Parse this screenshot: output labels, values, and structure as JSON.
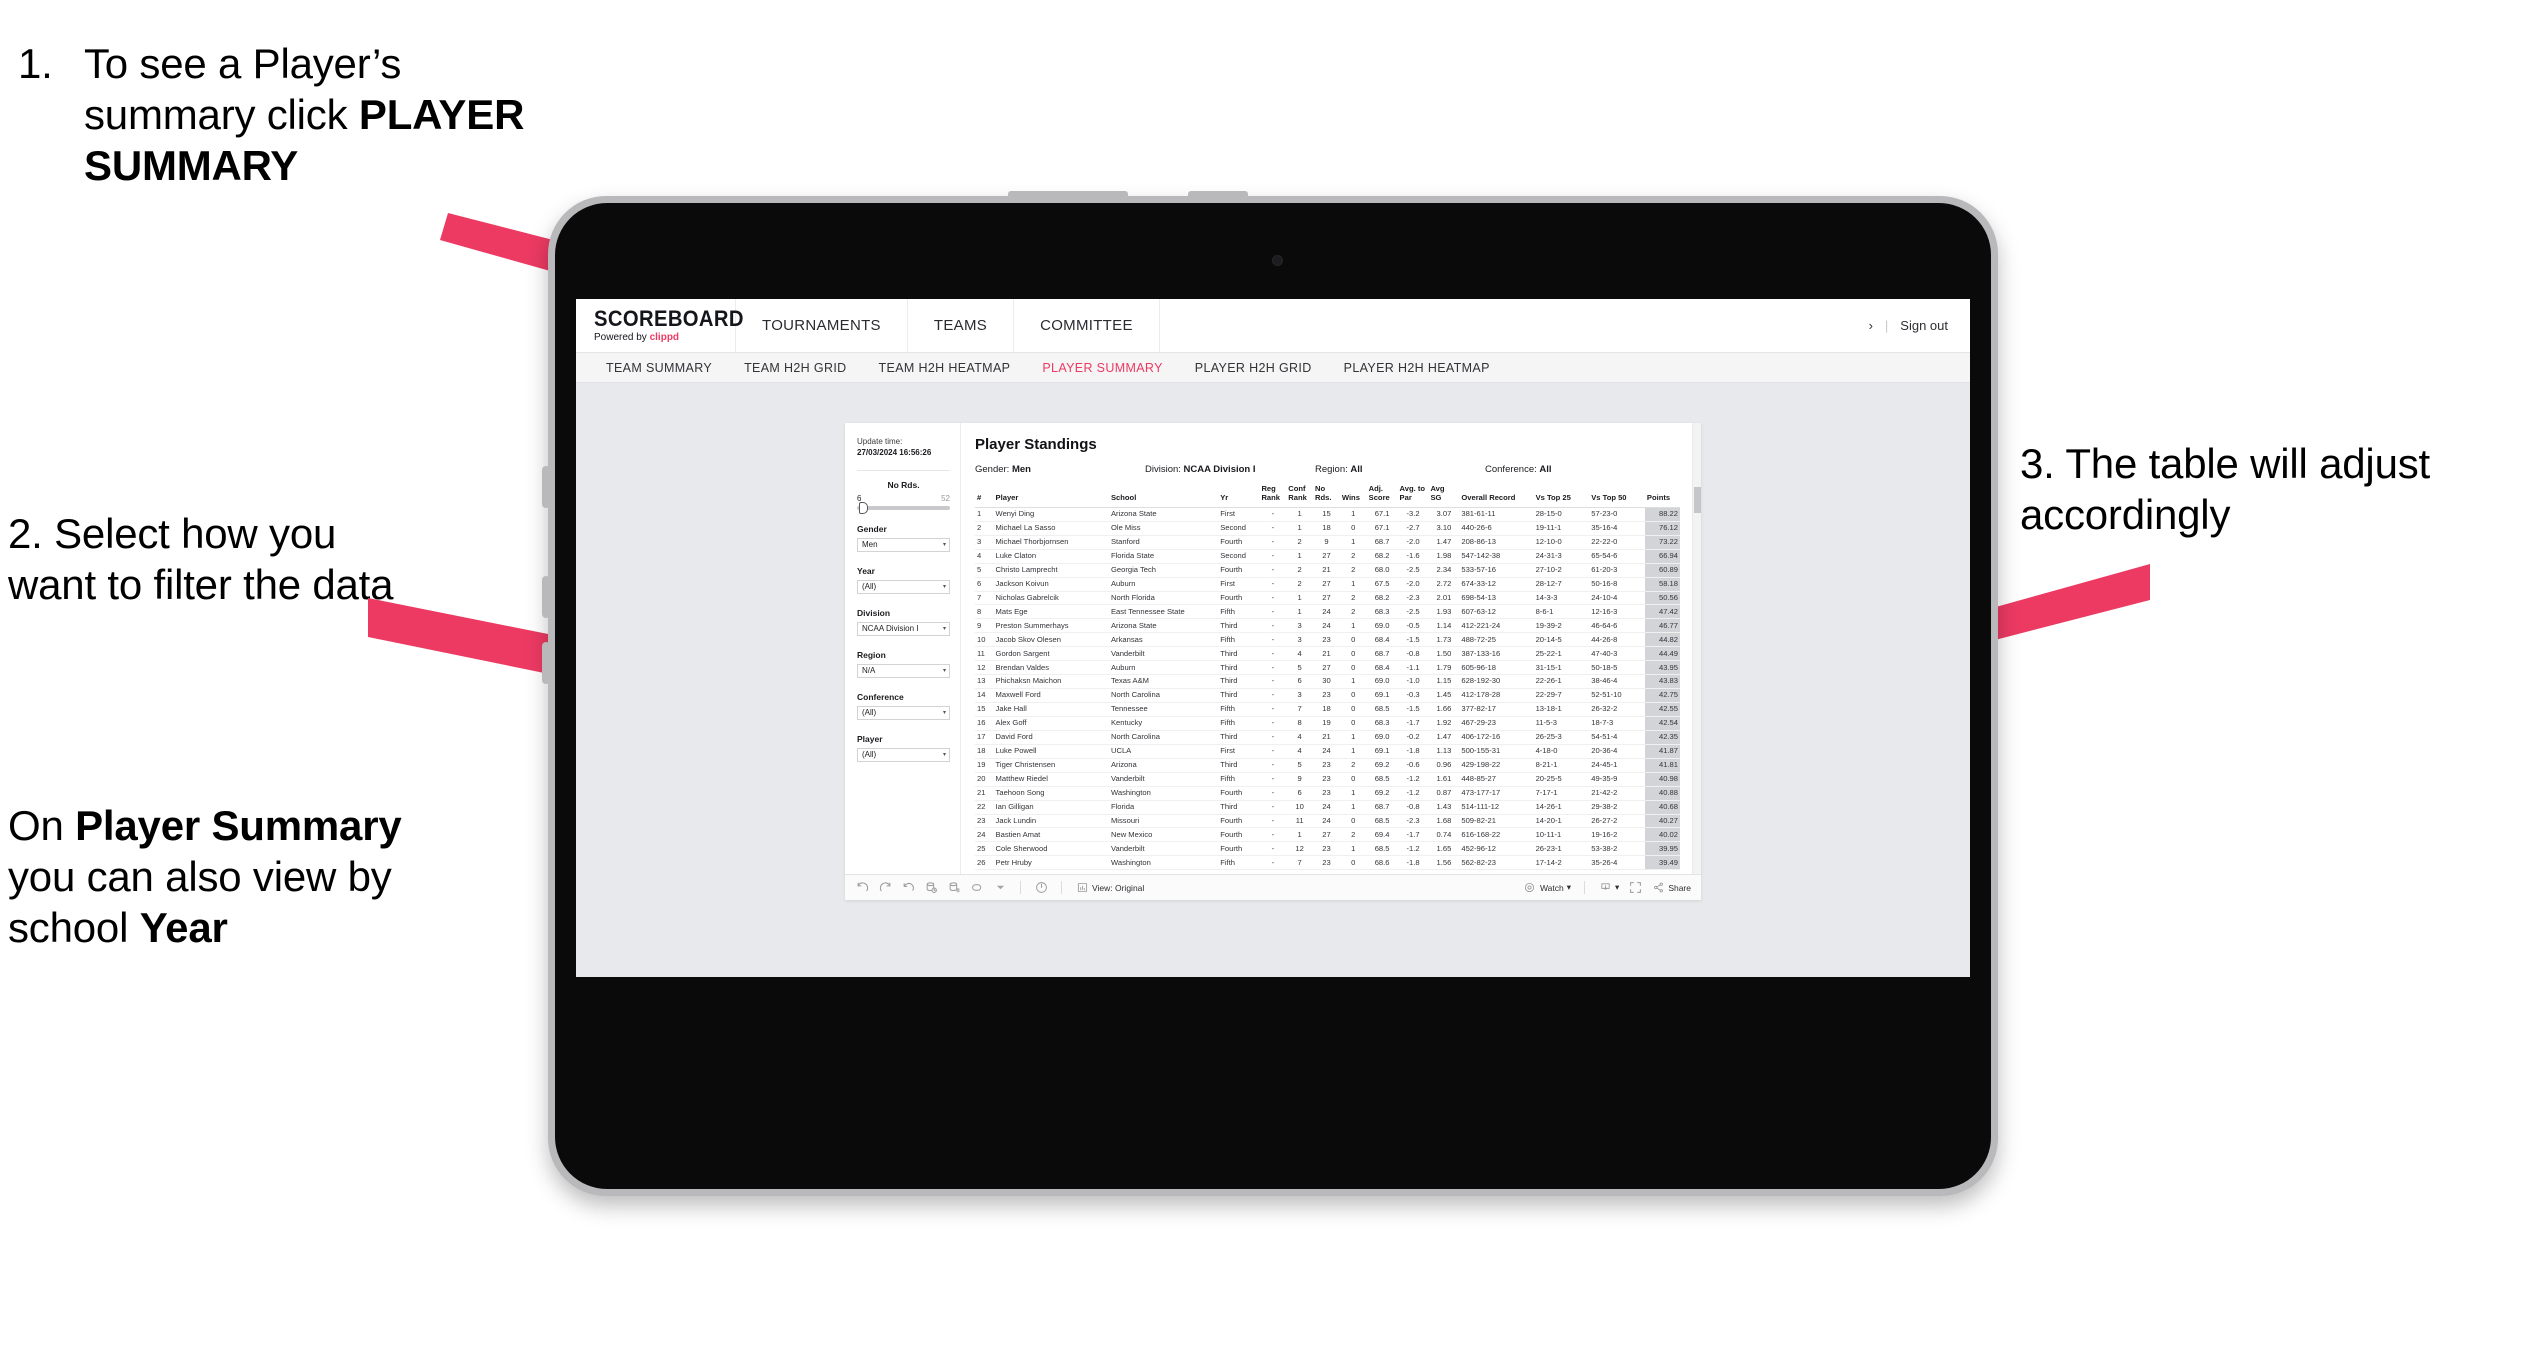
{
  "annotations": {
    "one": {
      "number": "1.",
      "text_before": "To see a Player’s summary click ",
      "bold": "PLAYER SUMMARY"
    },
    "two": {
      "text": "2. Select how you want to filter the data"
    },
    "two_b": {
      "prefix": "On ",
      "bold1": "Player Summary",
      "middle": " you can also view by school ",
      "bold2": "Year"
    },
    "three": {
      "text": "3. The table will adjust accordingly"
    },
    "arrow_color": "#ec3a63"
  },
  "app": {
    "brand": {
      "name": "SCOREBOARD",
      "powered_prefix": "Powered by ",
      "powered_brand": "clippd"
    },
    "nav": [
      {
        "label": "TOURNAMENTS"
      },
      {
        "label": "TEAMS"
      },
      {
        "label": "COMMITTEE"
      }
    ],
    "nav_right": {
      "chevron": "›",
      "divider": "|",
      "sign_out": "Sign out"
    },
    "subnav": [
      {
        "label": "TEAM SUMMARY",
        "active": false
      },
      {
        "label": "TEAM H2H GRID",
        "active": false
      },
      {
        "label": "TEAM H2H HEATMAP",
        "active": false
      },
      {
        "label": "PLAYER SUMMARY",
        "active": true
      },
      {
        "label": "PLAYER H2H GRID",
        "active": false
      },
      {
        "label": "PLAYER H2H HEATMAP",
        "active": false
      }
    ],
    "accent_color": "#ec3a63"
  },
  "filters": {
    "update_label": "Update time:",
    "update_time": "27/03/2024 16:56:26",
    "slider": {
      "title": "No Rds.",
      "min": "6",
      "max": "52"
    },
    "selects": [
      {
        "title": "Gender",
        "value": "Men"
      },
      {
        "title": "Year",
        "value": "(All)"
      },
      {
        "title": "Division",
        "value": "NCAA Division I"
      },
      {
        "title": "Region",
        "value": "N/A"
      },
      {
        "title": "Conference",
        "value": "(All)"
      },
      {
        "title": "Player",
        "value": "(All)"
      }
    ],
    "caret": "▾"
  },
  "standings": {
    "title": "Player Standings",
    "summary": [
      {
        "label": "Gender: ",
        "value": "Men"
      },
      {
        "label": "Division: ",
        "value": "NCAA Division I"
      },
      {
        "label": "Region: ",
        "value": "All"
      },
      {
        "label": "Conference: ",
        "value": "All"
      }
    ],
    "columns": [
      "#",
      "Player",
      "School",
      "Yr",
      "Reg Rank",
      "Conf Rank",
      "No Rds.",
      "Wins",
      "Adj. Score",
      "Avg. to Par",
      "Avg SG",
      "Overall Record",
      "Vs Top 25",
      "Vs Top 50",
      "Points"
    ],
    "rows": [
      [
        "1",
        "Wenyi Ding",
        "Arizona State",
        "First",
        "-",
        "1",
        "15",
        "1",
        "67.1",
        "-3.2",
        "3.07",
        "381-61-11",
        "28-15-0",
        "57-23-0",
        "88.22"
      ],
      [
        "2",
        "Michael La Sasso",
        "Ole Miss",
        "Second",
        "-",
        "1",
        "18",
        "0",
        "67.1",
        "-2.7",
        "3.10",
        "440-26-6",
        "19-11-1",
        "35-16-4",
        "76.12"
      ],
      [
        "3",
        "Michael Thorbjornsen",
        "Stanford",
        "Fourth",
        "-",
        "2",
        "9",
        "1",
        "68.7",
        "-2.0",
        "1.47",
        "208-86-13",
        "12-10-0",
        "22-22-0",
        "73.22"
      ],
      [
        "4",
        "Luke Claton",
        "Florida State",
        "Second",
        "-",
        "1",
        "27",
        "2",
        "68.2",
        "-1.6",
        "1.98",
        "547-142-38",
        "24-31-3",
        "65-54-6",
        "66.94"
      ],
      [
        "5",
        "Christo Lamprecht",
        "Georgia Tech",
        "Fourth",
        "-",
        "2",
        "21",
        "2",
        "68.0",
        "-2.5",
        "2.34",
        "533-57-16",
        "27-10-2",
        "61-20-3",
        "60.89"
      ],
      [
        "6",
        "Jackson Koivun",
        "Auburn",
        "First",
        "-",
        "2",
        "27",
        "1",
        "67.5",
        "-2.0",
        "2.72",
        "674-33-12",
        "28-12-7",
        "50-16-8",
        "58.18"
      ],
      [
        "7",
        "Nicholas Gabrelcik",
        "North Florida",
        "Fourth",
        "-",
        "1",
        "27",
        "2",
        "68.2",
        "-2.3",
        "2.01",
        "698-54-13",
        "14-3-3",
        "24-10-4",
        "50.56"
      ],
      [
        "8",
        "Mats Ege",
        "East Tennessee State",
        "Fifth",
        "-",
        "1",
        "24",
        "2",
        "68.3",
        "-2.5",
        "1.93",
        "607-63-12",
        "8-6-1",
        "12-16-3",
        "47.42"
      ],
      [
        "9",
        "Preston Summerhays",
        "Arizona State",
        "Third",
        "-",
        "3",
        "24",
        "1",
        "69.0",
        "-0.5",
        "1.14",
        "412-221-24",
        "19-39-2",
        "46-64-6",
        "46.77"
      ],
      [
        "10",
        "Jacob Skov Olesen",
        "Arkansas",
        "Fifth",
        "-",
        "3",
        "23",
        "0",
        "68.4",
        "-1.5",
        "1.73",
        "488-72-25",
        "20-14-5",
        "44-26-8",
        "44.82"
      ],
      [
        "11",
        "Gordon Sargent",
        "Vanderbilt",
        "Third",
        "-",
        "4",
        "21",
        "0",
        "68.7",
        "-0.8",
        "1.50",
        "387-133-16",
        "25-22-1",
        "47-40-3",
        "44.49"
      ],
      [
        "12",
        "Brendan Valdes",
        "Auburn",
        "Third",
        "-",
        "5",
        "27",
        "0",
        "68.4",
        "-1.1",
        "1.79",
        "605-96-18",
        "31-15-1",
        "50-18-5",
        "43.95"
      ],
      [
        "13",
        "Phichaksn Maichon",
        "Texas A&M",
        "Third",
        "-",
        "6",
        "30",
        "1",
        "69.0",
        "-1.0",
        "1.15",
        "628-192-30",
        "22-26-1",
        "38-46-4",
        "43.83"
      ],
      [
        "14",
        "Maxwell Ford",
        "North Carolina",
        "Third",
        "-",
        "3",
        "23",
        "0",
        "69.1",
        "-0.3",
        "1.45",
        "412-178-28",
        "22-29-7",
        "52-51-10",
        "42.75"
      ],
      [
        "15",
        "Jake Hall",
        "Tennessee",
        "Fifth",
        "-",
        "7",
        "18",
        "0",
        "68.5",
        "-1.5",
        "1.66",
        "377-82-17",
        "13-18-1",
        "26-32-2",
        "42.55"
      ],
      [
        "16",
        "Alex Goff",
        "Kentucky",
        "Fifth",
        "-",
        "8",
        "19",
        "0",
        "68.3",
        "-1.7",
        "1.92",
        "467-29-23",
        "11-5-3",
        "18-7-3",
        "42.54"
      ],
      [
        "17",
        "David Ford",
        "North Carolina",
        "Third",
        "-",
        "4",
        "21",
        "1",
        "69.0",
        "-0.2",
        "1.47",
        "406-172-16",
        "26-25-3",
        "54-51-4",
        "42.35"
      ],
      [
        "18",
        "Luke Powell",
        "UCLA",
        "First",
        "-",
        "4",
        "24",
        "1",
        "69.1",
        "-1.8",
        "1.13",
        "500-155-31",
        "4-18-0",
        "20-36-4",
        "41.87"
      ],
      [
        "19",
        "Tiger Christensen",
        "Arizona",
        "Third",
        "-",
        "5",
        "23",
        "2",
        "69.2",
        "-0.6",
        "0.96",
        "429-198-22",
        "8-21-1",
        "24-45-1",
        "41.81"
      ],
      [
        "20",
        "Matthew Riedel",
        "Vanderbilt",
        "Fifth",
        "-",
        "9",
        "23",
        "0",
        "68.5",
        "-1.2",
        "1.61",
        "448-85-27",
        "20-25-5",
        "49-35-9",
        "40.98"
      ],
      [
        "21",
        "Taehoon Song",
        "Washington",
        "Fourth",
        "-",
        "6",
        "23",
        "1",
        "69.2",
        "-1.2",
        "0.87",
        "473-177-17",
        "7-17-1",
        "21-42-2",
        "40.88"
      ],
      [
        "22",
        "Ian Gilligan",
        "Florida",
        "Third",
        "-",
        "10",
        "24",
        "1",
        "68.7",
        "-0.8",
        "1.43",
        "514-111-12",
        "14-26-1",
        "29-38-2",
        "40.68"
      ],
      [
        "23",
        "Jack Lundin",
        "Missouri",
        "Fourth",
        "-",
        "11",
        "24",
        "0",
        "68.5",
        "-2.3",
        "1.68",
        "509-82-21",
        "14-20-1",
        "26-27-2",
        "40.27"
      ],
      [
        "24",
        "Bastien Amat",
        "New Mexico",
        "Fourth",
        "-",
        "1",
        "27",
        "2",
        "69.4",
        "-1.7",
        "0.74",
        "616-168-22",
        "10-11-1",
        "19-16-2",
        "40.02"
      ],
      [
        "25",
        "Cole Sherwood",
        "Vanderbilt",
        "Fourth",
        "-",
        "12",
        "23",
        "1",
        "68.5",
        "-1.2",
        "1.65",
        "452-96-12",
        "26-23-1",
        "53-38-2",
        "39.95"
      ],
      [
        "26",
        "Petr Hruby",
        "Washington",
        "Fifth",
        "-",
        "7",
        "23",
        "0",
        "68.6",
        "-1.8",
        "1.56",
        "562-82-23",
        "17-14-2",
        "35-26-4",
        "39.49"
      ]
    ]
  },
  "toolbar": {
    "view_label": "View: Original",
    "watch_label": "Watch",
    "share_label": "Share",
    "caret": "▾",
    "icons": [
      "undo-icon",
      "redo-icon",
      "revert-icon",
      "refresh-data-icon",
      "pause-updates-icon",
      "alert-icon",
      "chevron-down-icon",
      "zoom-icon",
      "view-original-icon",
      "watch-icon",
      "download-icon",
      "fullscreen-icon",
      "share-icon"
    ]
  }
}
